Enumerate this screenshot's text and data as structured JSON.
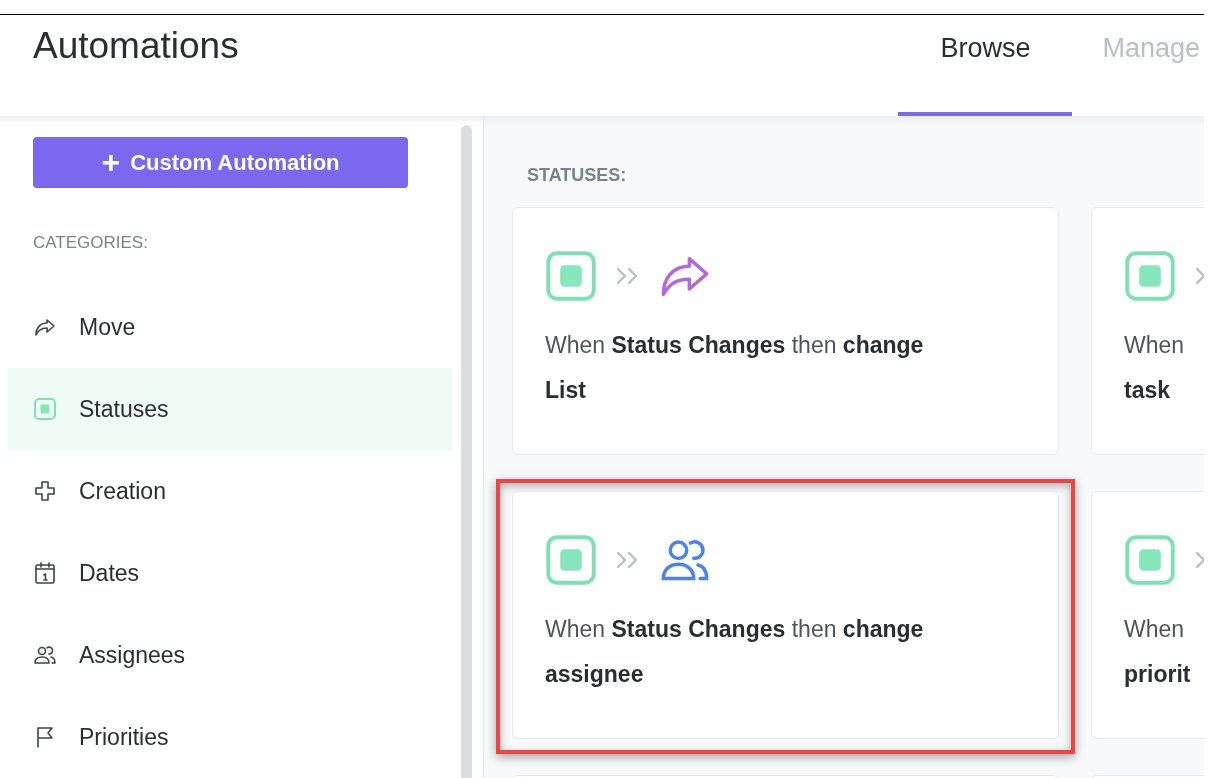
{
  "header": {
    "title": "Automations"
  },
  "tabs": [
    {
      "label": "Browse",
      "selected": true
    },
    {
      "label": "Manage",
      "selected": false
    }
  ],
  "sidebar": {
    "button": "Custom Automation",
    "button_icon": "+",
    "heading": "CATEGORIES:",
    "items": [
      {
        "label": "Move",
        "kind": "move",
        "selected": false
      },
      {
        "label": "Statuses",
        "kind": "status",
        "selected": true
      },
      {
        "label": "Creation",
        "kind": "creation",
        "selected": false
      },
      {
        "label": "Dates",
        "kind": "dates",
        "selected": false
      },
      {
        "label": "Assignees",
        "kind": "assignees",
        "selected": false
      },
      {
        "label": "Priorities",
        "kind": "priorities",
        "selected": false
      }
    ]
  },
  "section": {
    "heading": "STATUSES:",
    "cards": [
      {
        "kind": "move",
        "highlighted": false,
        "lines": [
          "When **Status Changes** then **change**",
          "**List**"
        ]
      },
      {
        "kind": "clipped",
        "highlighted": false,
        "lines": [
          "When",
          "**task**"
        ]
      },
      {
        "kind": "assignees",
        "highlighted": true,
        "lines": [
          "When **Status Changes** then **change**",
          "**assignee**"
        ]
      },
      {
        "kind": "clipped",
        "highlighted": false,
        "lines": [
          "When",
          "**priorit**"
        ]
      }
    ]
  }
}
